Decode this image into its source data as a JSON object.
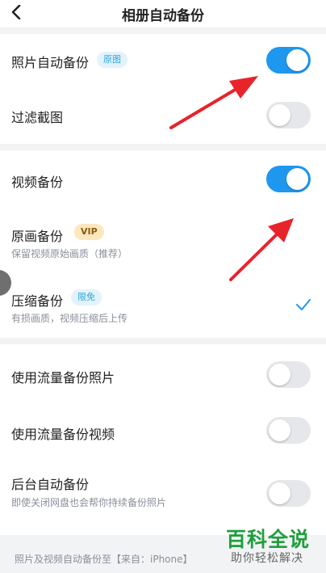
{
  "header": {
    "title": "相册自动备份",
    "back_icon": "chevron-left-icon"
  },
  "photo_section": {
    "photo_backup": {
      "label": "照片自动备份",
      "badge": "原图",
      "toggle_on": true
    },
    "filter_screenshots": {
      "label": "过滤截图",
      "toggle_on": false
    }
  },
  "video_section": {
    "video_backup": {
      "label": "视频备份",
      "toggle_on": true
    },
    "original_quality": {
      "label": "原画备份",
      "badge": "VIP",
      "sub": "保留视频原始画质（推荐）"
    },
    "compressed": {
      "label": "压缩备份",
      "badge": "限免",
      "sub": "有损画质，视频压缩后上传",
      "selected": true
    }
  },
  "other_section": {
    "cellular_photos": {
      "label": "使用流量备份照片",
      "toggle_on": false
    },
    "cellular_videos": {
      "label": "使用流量备份视频",
      "toggle_on": false
    },
    "background_backup": {
      "label": "后台自动备份",
      "sub": "即使关闭网盘也会帮你持续备份照片",
      "toggle_on": false
    }
  },
  "footer": {
    "text": "照片及视频自动备份至【来自：iPhone】"
  },
  "watermark": {
    "line1": "百科全说",
    "line2": "助你轻松解决"
  },
  "colors": {
    "accent": "#1e97ef",
    "arrow": "#e8232a",
    "watermark": "#1f9e3c"
  }
}
